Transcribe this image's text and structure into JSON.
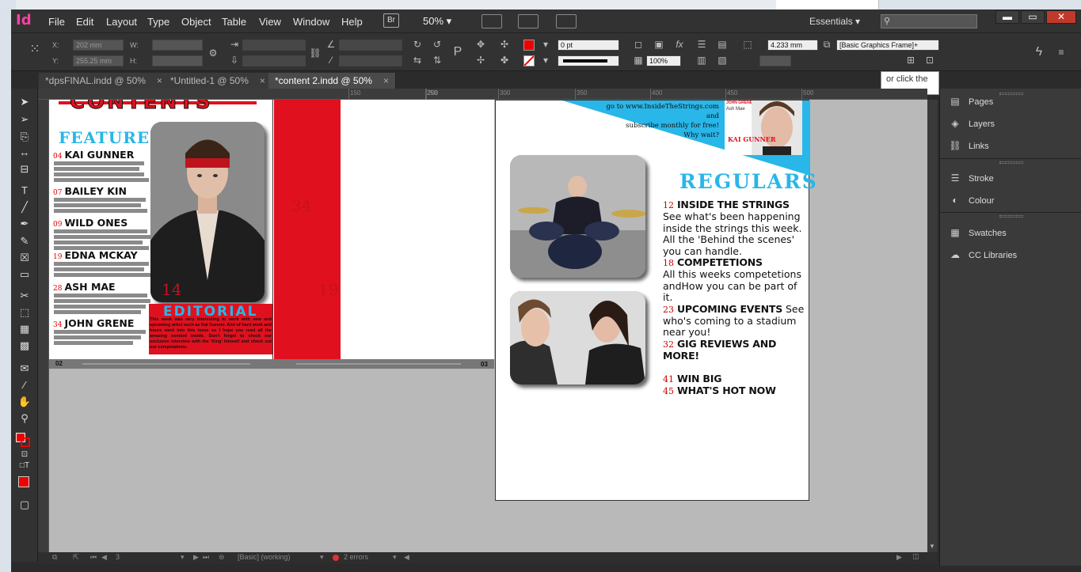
{
  "app": {
    "logo": "Id"
  },
  "menu": [
    "File",
    "Edit",
    "Layout",
    "Type",
    "Object",
    "Table",
    "View",
    "Window",
    "Help"
  ],
  "toolbar": {
    "bridge_label": "Br",
    "zoom": "50%",
    "workspace": "Essentials",
    "window_min": "▬",
    "window_max": "▭",
    "window_close": "✕"
  },
  "control": {
    "x_label": "X:",
    "x_value": "202 mm",
    "y_label": "Y:",
    "y_value": "255.25 mm",
    "w_label": "W:",
    "h_label": "H:",
    "stroke_weight": "0 pt",
    "opacity": "100%",
    "gap": "4.233 mm",
    "frame_style": "[Basic Graphics Frame]+"
  },
  "tabs": [
    {
      "label": "*dpsFINAL.indd @ 50%"
    },
    {
      "label": "*Untitled-1 @ 50%"
    },
    {
      "label": "*content 2.indd @ 50%"
    }
  ],
  "tab_close": "×",
  "tooltip": "or click the",
  "ruler": {
    "ticks": [
      "150",
      "200",
      "250",
      "300",
      "350",
      "400",
      "450",
      "500"
    ]
  },
  "panels": [
    "Pages",
    "Layers",
    "Links",
    "Stroke",
    "Colour",
    "Swatches",
    "CC Libraries"
  ],
  "status": {
    "page": "3",
    "style": "[Basic] (working)",
    "errors": "2 errors"
  },
  "doc": {
    "contents_title": "CONTENTS",
    "features_title": "FEATURES",
    "features": [
      {
        "num": "04",
        "name": "KAI GUNNER"
      },
      {
        "num": "07",
        "name": "BAILEY KIN"
      },
      {
        "num": "09",
        "name": "WILD ONES"
      },
      {
        "num": "19",
        "name": "EDNA MCKAY"
      },
      {
        "num": "28",
        "name": "ASH MAE"
      },
      {
        "num": "34",
        "name": "JOHN GRENE"
      }
    ],
    "photo_page_num": "14",
    "editorial_title": "EDITORIAL",
    "editorial_text": "This week was very interesting to work with new and upcoming artist such as Kai Gunner. Alot of hard work and hours went into this issue so I hope you read all the amazing content inside. Don't forget to check our exclusive interview with the 'King' himself and check out our competations.",
    "ghost_num_1": "34",
    "ghost_num_2": "19",
    "page_num_left": "02",
    "page_num_right": "03",
    "promo_text": [
      "go to www.InsideTheStrings.com and",
      "subscribe monthly for free!",
      "Why wait?"
    ],
    "cover_name": "KAI GUNNER",
    "cover_brand": "JOHN GRENE",
    "cover_sub": "Ash Mae",
    "regulars_title": "REGULARS",
    "regulars": [
      {
        "num": "12",
        "title": "INSIDE THE STRINGS",
        "desc": "See what's been happening inside the strings this week. All the 'Behind the scenes' you can handle."
      },
      {
        "num": "18",
        "title": "COMPETETIONS",
        "desc": "All this weeks competetions andHow you can be part of it."
      },
      {
        "num": "23",
        "title": "UPCOMING EVENTS",
        "desc": "See who's coming to a stadium near you!"
      },
      {
        "num": "32",
        "title": "GIG REVIEWS AND MORE!",
        "desc": ""
      },
      {
        "num": "41",
        "title": "WIN BIG",
        "desc": ""
      },
      {
        "num": "45",
        "title": "WHAT'S HOT NOW",
        "desc": ""
      }
    ]
  },
  "colors": {
    "accent_red": "#e0101e",
    "cyan": "#29b6e8",
    "indesign_pink": "#ff3fa4"
  }
}
